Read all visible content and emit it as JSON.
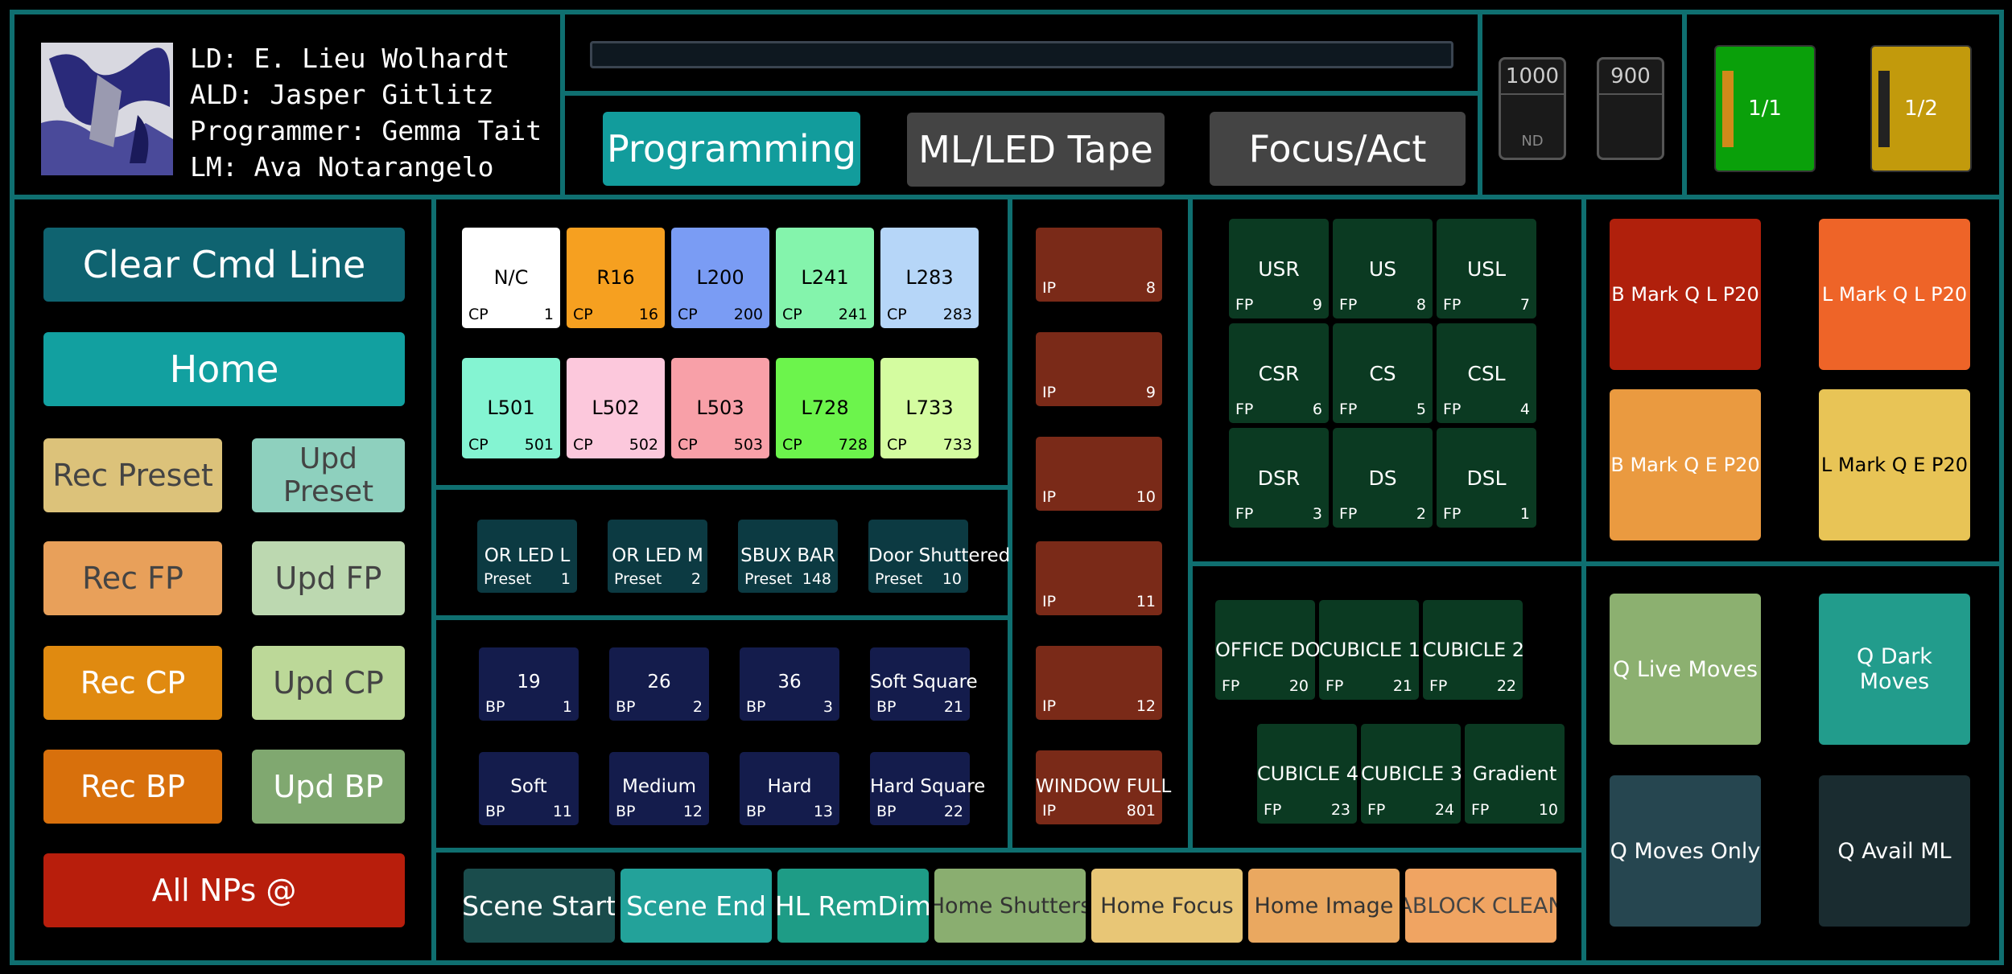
{
  "credits": {
    "ld": "LD: E. Lieu Wolhardt",
    "ald": "ALD: Jasper Gitlitz",
    "programmer": "Programmer: Gemma Tait",
    "lm": "LM: Ava Notarangelo"
  },
  "tabs": [
    {
      "label": "Programming",
      "color": "#129c9c",
      "active": true
    },
    {
      "label": "ML/LED Tape",
      "color": "#444444",
      "active": false
    },
    {
      "label": "Focus/Act",
      "color": "#444444",
      "active": false
    }
  ],
  "faders": [
    {
      "label": "1000",
      "sub": "ND"
    },
    {
      "label": "900",
      "sub": ""
    }
  ],
  "pages": [
    {
      "label": "1/1",
      "color": "#0aa00a",
      "bar": "#d08a1a"
    },
    {
      "label": "1/2",
      "color": "#c29a0c",
      "bar": "#222222"
    }
  ],
  "commands": {
    "clear": {
      "label": "Clear Cmd Line",
      "color": "#0f6370"
    },
    "home": {
      "label": "Home",
      "color": "#12a0a0"
    },
    "rec_preset": {
      "label": "Rec Preset",
      "color": "#dcc27a"
    },
    "upd_preset": {
      "label": "Upd Preset",
      "color": "#8ed0be"
    },
    "rec_fp": {
      "label": "Rec FP",
      "color": "#e8a05a"
    },
    "upd_fp": {
      "label": "Upd FP",
      "color": "#bcd8b0"
    },
    "rec_cp": {
      "label": "Rec CP",
      "color": "#e08a10"
    },
    "upd_cp": {
      "label": "Upd CP",
      "color": "#bcd898"
    },
    "rec_bp": {
      "label": "Rec BP",
      "color": "#d8700c"
    },
    "upd_bp": {
      "label": "Upd BP",
      "color": "#80a870"
    },
    "all_nps": {
      "label": "All NPs @",
      "color": "#b81e0c"
    }
  },
  "color_palettes": [
    {
      "name": "N/C",
      "type": "CP",
      "num": "1",
      "color": "#ffffff",
      "text": "#000000"
    },
    {
      "name": "R16",
      "type": "CP",
      "num": "16",
      "color": "#f6a020",
      "text": "#000000"
    },
    {
      "name": "L200",
      "type": "CP",
      "num": "200",
      "color": "#7a9cf4",
      "text": "#000000"
    },
    {
      "name": "L241",
      "type": "CP",
      "num": "241",
      "color": "#84f4ac",
      "text": "#000000"
    },
    {
      "name": "L283",
      "type": "CP",
      "num": "283",
      "color": "#b6d6f8",
      "text": "#000000"
    },
    {
      "name": "L501",
      "type": "CP",
      "num": "501",
      "color": "#84f4d2",
      "text": "#000000"
    },
    {
      "name": "L502",
      "type": "CP",
      "num": "502",
      "color": "#fcc8dc",
      "text": "#000000"
    },
    {
      "name": "L503",
      "type": "CP",
      "num": "503",
      "color": "#f8a0a8",
      "text": "#000000"
    },
    {
      "name": "L728",
      "type": "CP",
      "num": "728",
      "color": "#6cf44c",
      "text": "#000000"
    },
    {
      "name": "L733",
      "type": "CP",
      "num": "733",
      "color": "#d4fca0",
      "text": "#000000"
    }
  ],
  "presets": [
    {
      "name": "OR LED L",
      "type": "Preset",
      "num": "1"
    },
    {
      "name": "OR LED M",
      "type": "Preset",
      "num": "2"
    },
    {
      "name": "SBUX BAR",
      "type": "Preset",
      "num": "148"
    },
    {
      "name": "Door Shuttered",
      "type": "Preset",
      "num": "10"
    }
  ],
  "beam_palettes": [
    {
      "name": "19",
      "type": "BP",
      "num": "1"
    },
    {
      "name": "26",
      "type": "BP",
      "num": "2"
    },
    {
      "name": "36",
      "type": "BP",
      "num": "3"
    },
    {
      "name": "Soft Square",
      "type": "BP",
      "num": "21"
    },
    {
      "name": "Soft",
      "type": "BP",
      "num": "11"
    },
    {
      "name": "Medium",
      "type": "BP",
      "num": "12"
    },
    {
      "name": "Hard",
      "type": "BP",
      "num": "13"
    },
    {
      "name": "Hard Square",
      "type": "BP",
      "num": "22"
    }
  ],
  "intensity_palettes": [
    {
      "name": "",
      "type": "IP",
      "num": "8"
    },
    {
      "name": "",
      "type": "IP",
      "num": "9"
    },
    {
      "name": "",
      "type": "IP",
      "num": "10"
    },
    {
      "name": "",
      "type": "IP",
      "num": "11"
    },
    {
      "name": "",
      "type": "IP",
      "num": "12"
    },
    {
      "name": "WINDOW FULL",
      "type": "IP",
      "num": "801"
    }
  ],
  "focus_stage": [
    {
      "name": "USR",
      "type": "FP",
      "num": "9"
    },
    {
      "name": "US",
      "type": "FP",
      "num": "8"
    },
    {
      "name": "USL",
      "type": "FP",
      "num": "7"
    },
    {
      "name": "CSR",
      "type": "FP",
      "num": "6"
    },
    {
      "name": "CS",
      "type": "FP",
      "num": "5"
    },
    {
      "name": "CSL",
      "type": "FP",
      "num": "4"
    },
    {
      "name": "DSR",
      "type": "FP",
      "num": "3"
    },
    {
      "name": "DS",
      "type": "FP",
      "num": "2"
    },
    {
      "name": "DSL",
      "type": "FP",
      "num": "1"
    }
  ],
  "focus_office": [
    {
      "name": "OFFICE DOO",
      "type": "FP",
      "num": "20"
    },
    {
      "name": "CUBICLE 1",
      "type": "FP",
      "num": "21"
    },
    {
      "name": "CUBICLE 2",
      "type": "FP",
      "num": "22"
    },
    {
      "name": "CUBICLE 4",
      "type": "FP",
      "num": "23"
    },
    {
      "name": "CUBICLE 3",
      "type": "FP",
      "num": "24"
    },
    {
      "name": "Gradient",
      "type": "FP",
      "num": "10"
    }
  ],
  "marks": [
    {
      "label": "B Mark Q L P20",
      "color": "#b0200c"
    },
    {
      "label": "L Mark Q L P20",
      "color": "#ee6428"
    },
    {
      "label": "B Mark Q E P20",
      "color": "#ea9a40"
    },
    {
      "label": "L Mark Q E P20",
      "color": "#e8c456",
      "text": "#000000"
    }
  ],
  "cue_moves": [
    {
      "label": "Q Live Moves",
      "color": "#8cb070"
    },
    {
      "label": "Q Dark Moves",
      "color": "#229c8c"
    },
    {
      "label": "Q Moves Only",
      "color": "#264650"
    },
    {
      "label": "Q Avail ML",
      "color": "#1a2c30"
    }
  ],
  "macros": [
    {
      "label": "Scene Start",
      "color": "#1a4c4c",
      "text": "#ffffff"
    },
    {
      "label": "Scene End",
      "color": "#23a29a",
      "text": "#ffffff"
    },
    {
      "label": "HL RemDim",
      "color": "#1e9c86",
      "text": "#ffffff"
    },
    {
      "label": "Home Shutters",
      "color": "#8aae70",
      "text": "#333333"
    },
    {
      "label": "Home Focus",
      "color": "#e8c676",
      "text": "#333333"
    },
    {
      "label": "Home Image",
      "color": "#eaa860",
      "text": "#333333"
    },
    {
      "label": "ABLOCK CLEAN",
      "color": "#f0a462",
      "text": "#444444"
    }
  ]
}
